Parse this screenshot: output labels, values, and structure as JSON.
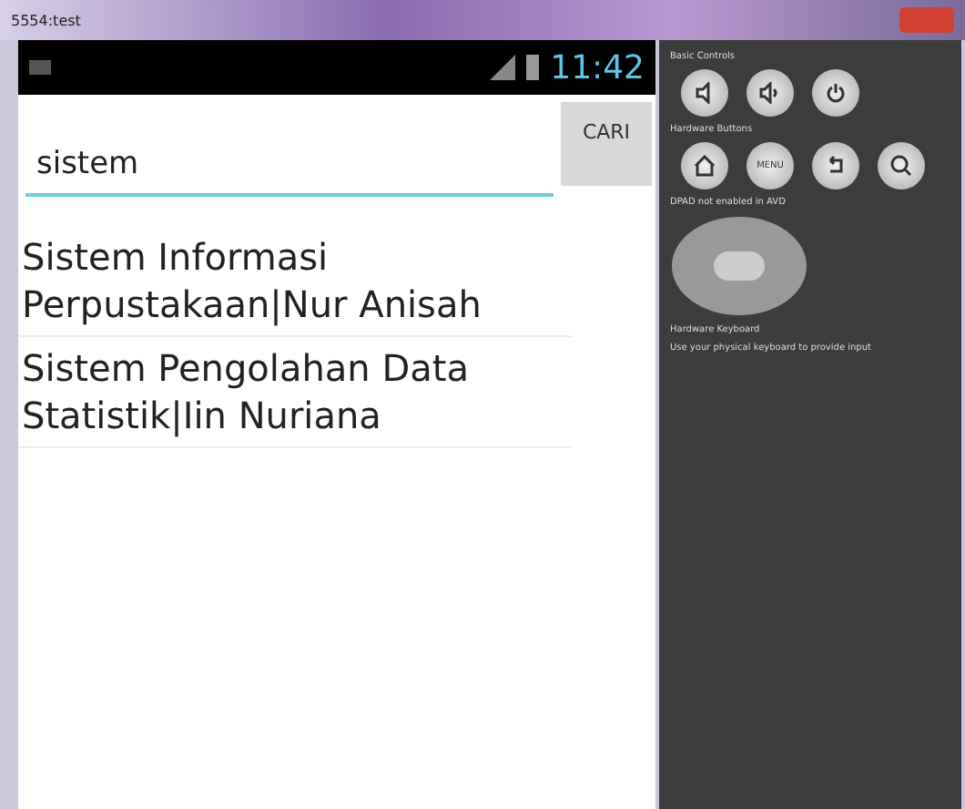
{
  "window": {
    "title": "5554:test"
  },
  "status_bar": {
    "time": "11:42"
  },
  "search": {
    "value": "sistem",
    "button": "CARI"
  },
  "results": [
    {
      "text": "Sistem Informasi Perpustakaan|Nur Anisah"
    },
    {
      "text": "Sistem Pengolahan Data Statistik|Iin Nuriana"
    }
  ],
  "controls": {
    "basic_label": "Basic Controls",
    "hardware_label": "Hardware Buttons",
    "menu_button": "MENU",
    "dpad_label": "DPAD not enabled in AVD",
    "keyboard_label": "Hardware Keyboard",
    "keyboard_note": "Use your physical keyboard to provide input"
  }
}
